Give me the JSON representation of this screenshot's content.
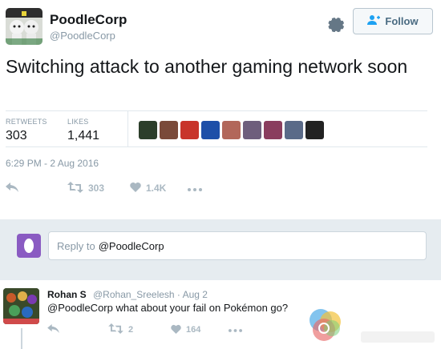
{
  "user": {
    "display_name": "PoodleCorp",
    "handle": "@PoodleCorp"
  },
  "header": {
    "follow_label": "Follow"
  },
  "tweet": {
    "text": "Switching attack to another gaming network soon",
    "timestamp": "6:29 PM - 2 Aug 2016"
  },
  "stats": {
    "retweets_label": "RETWEETS",
    "retweets_value": "303",
    "likes_label": "LIKES",
    "likes_value": "1,441"
  },
  "likers": [
    {
      "icon": "liker-avatar",
      "color": "#2c3e2a"
    },
    {
      "icon": "liker-avatar",
      "color": "#7a4a3a"
    },
    {
      "icon": "liker-avatar",
      "color": "#c8342a"
    },
    {
      "icon": "liker-avatar",
      "color": "#1e4fa8"
    },
    {
      "icon": "liker-avatar",
      "color": "#b2675a"
    },
    {
      "icon": "liker-avatar",
      "color": "#6e5e7c"
    },
    {
      "icon": "liker-avatar",
      "color": "#8a3d5e"
    },
    {
      "icon": "liker-avatar",
      "color": "#5a6a88"
    },
    {
      "icon": "liker-avatar",
      "color": "#222222"
    }
  ],
  "actions": {
    "retweet_count": "303",
    "like_count": "1.4K"
  },
  "reply_box": {
    "placeholder": "Reply to",
    "mention": "@PoodleCorp"
  },
  "reply": {
    "name": "Rohan S",
    "meta": "@Rohan_Sreelesh · Aug 2",
    "text": "@PoodleCorp what about your fail on Pokémon go?",
    "retweet_count": "2",
    "like_count": "164"
  },
  "colors": {
    "accent": "#1da1f2",
    "muted": "#8899a6",
    "reply_bg": "#e6ecf0"
  }
}
